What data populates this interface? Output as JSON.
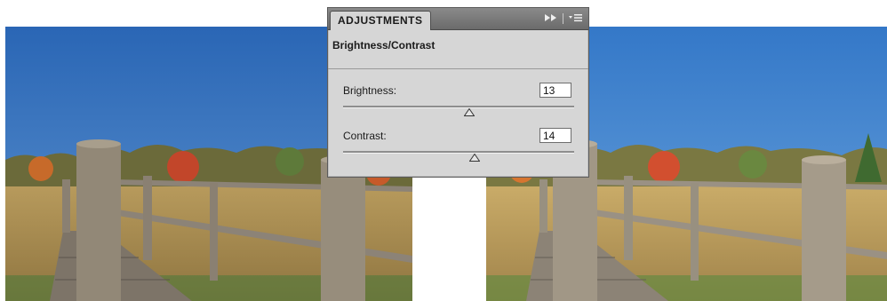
{
  "panel": {
    "tab_label": "ADJUSTMENTS",
    "forward_icon": "double-arrow-icon",
    "menu_icon": "panel-menu-icon",
    "title": "Brightness/Contrast",
    "brightness": {
      "label": "Brightness:",
      "value": "13"
    },
    "contrast": {
      "label": "Contrast:",
      "value": "14"
    }
  },
  "photos": {
    "left": {
      "kind": "before"
    },
    "right": {
      "kind": "after"
    }
  },
  "colors": {
    "sky_left": "#2f6fbf",
    "sky_right": "#3f85d0",
    "panel_bg": "#d6d6d6"
  }
}
